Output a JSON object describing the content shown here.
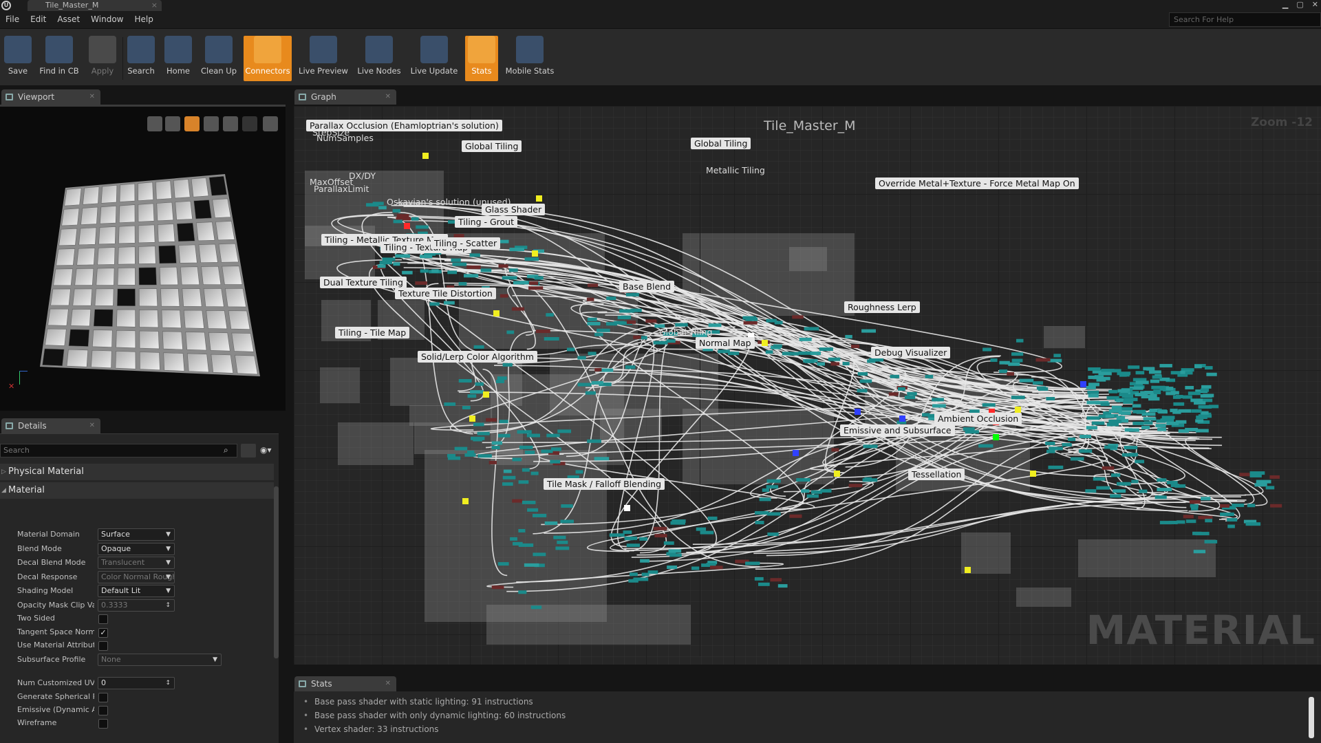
{
  "window": {
    "tab_title": "Tile_Master_M",
    "close": "×"
  },
  "menu": {
    "items": [
      "File",
      "Edit",
      "Asset",
      "Window",
      "Help"
    ],
    "help_placeholder": "Search For Help"
  },
  "toolbar": {
    "buttons": [
      {
        "label": "Save"
      },
      {
        "label": "Find in CB"
      },
      {
        "label": "Apply"
      },
      {
        "label": "Search"
      },
      {
        "label": "Home"
      },
      {
        "label": "Clean Up"
      },
      {
        "label": "Connectors"
      },
      {
        "label": "Live Preview"
      },
      {
        "label": "Live Nodes"
      },
      {
        "label": "Live Update"
      },
      {
        "label": "Stats"
      },
      {
        "label": "Mobile Stats"
      }
    ]
  },
  "panels": {
    "viewport": "Viewport",
    "graph": "Graph",
    "details": "Details",
    "stats": "Stats"
  },
  "graph": {
    "title": "Tile_Master_M",
    "zoom": "Zoom -12",
    "watermark": "MATERIAL",
    "comments": [
      "Parallax Occlusion (Ehamloptrian's solution)",
      "StepSize",
      "NumSamples",
      "DX/DY",
      "MaxOffset",
      "ParallaxLimit",
      "Oskavian's solution (unused)",
      "Global Tiling",
      "Glass Shader",
      "Tiling - Grout",
      "Tiling - Metallic Texture Map",
      "Tiling - Texture Map",
      "Tiling - Scatter",
      "Dual Texture Tiling",
      "Texture Tile Distortion",
      "Tiling - Tile Map",
      "Solid/Lerp Color Algorithm",
      "Base Blend",
      "Global Tiling",
      "Normal Map",
      "Global Tiling",
      "Metallic Tiling",
      "Override Metal+Texture - Force Metal Map On",
      "Roughness Lerp",
      "Debug Visualizer",
      "Emissive and Subsurface",
      "Ambient Occlusion",
      "Tessellation",
      "Tile Mask / Falloff Blending"
    ]
  },
  "details": {
    "search_placeholder": "Search",
    "categories": {
      "physical": "Physical Material",
      "material": "Material"
    },
    "props": [
      {
        "label": "Material Domain",
        "value": "Surface",
        "type": "dropdown"
      },
      {
        "label": "Blend Mode",
        "value": "Opaque",
        "type": "dropdown"
      },
      {
        "label": "Decal Blend Mode",
        "value": "Translucent",
        "type": "dropdown-disabled"
      },
      {
        "label": "Decal Response",
        "value": "Color Normal Roughness",
        "type": "dropdown-disabled"
      },
      {
        "label": "Shading Model",
        "value": "Default Lit",
        "type": "dropdown"
      },
      {
        "label": "Opacity Mask Clip Val",
        "value": "0.3333",
        "type": "number-disabled"
      },
      {
        "label": "Two Sided",
        "value": "",
        "type": "checkbox"
      },
      {
        "label": "Tangent Space Norma",
        "value": "✓",
        "type": "checkbox"
      },
      {
        "label": "Use Material Attribute",
        "value": "",
        "type": "checkbox"
      },
      {
        "label": "Subsurface Profile",
        "value": "None",
        "type": "dropdown-disabled"
      },
      {
        "label": "Num Customized UVs",
        "value": "0",
        "type": "number"
      },
      {
        "label": "Generate Spherical Pa",
        "value": "",
        "type": "checkbox"
      },
      {
        "label": "Emissive (Dynamic Ar",
        "value": "",
        "type": "checkbox"
      },
      {
        "label": "Wireframe",
        "value": "",
        "type": "checkbox"
      }
    ]
  },
  "stats": {
    "lines": [
      "Base pass shader with static lighting: 91 instructions",
      "Base pass shader with only dynamic lighting: 60 instructions",
      "Vertex shader: 33 instructions"
    ]
  },
  "colors": {
    "accent": "#e88a1d",
    "panel": "#262626",
    "graph_bg": "#2b2b2b"
  }
}
